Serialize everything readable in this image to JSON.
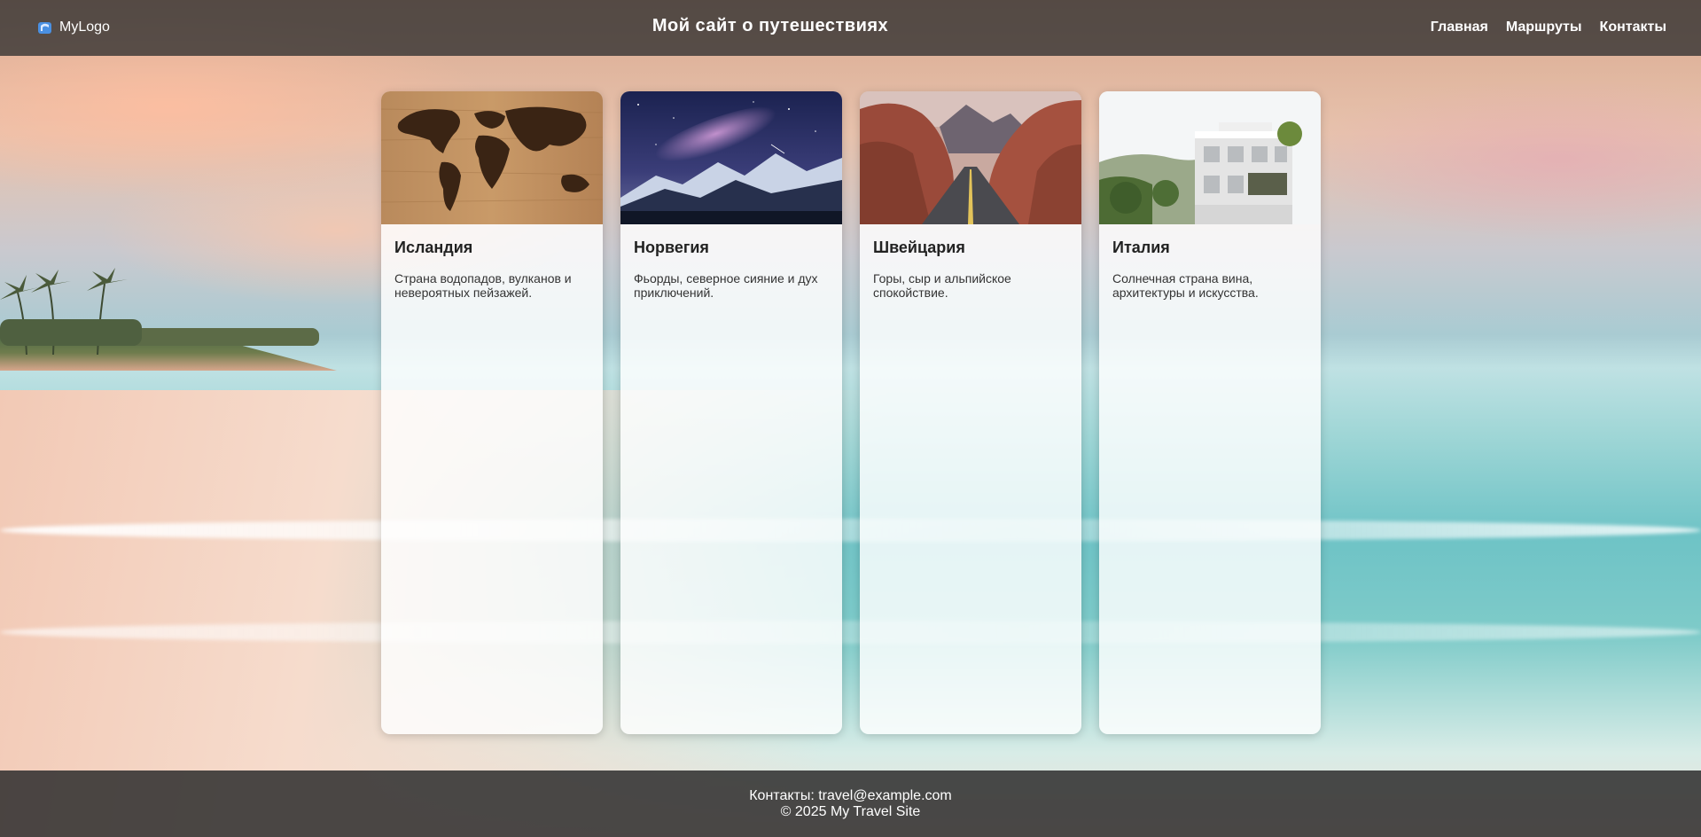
{
  "header": {
    "logo_text": "MyLogo",
    "site_title": "Мой сайт о путешествиях",
    "nav": [
      {
        "label": "Главная"
      },
      {
        "label": "Маршруты"
      },
      {
        "label": "Контакты"
      }
    ]
  },
  "cards": [
    {
      "title": "Исландия",
      "text": "Страна водопадов, вулканов и невероятных пейзажей.",
      "image": "world-map-on-wood"
    },
    {
      "title": "Норвегия",
      "text": "Фьорды, северное сияние и дух приключений.",
      "image": "night-mountains-milky-way"
    },
    {
      "title": "Швейцария",
      "text": "Горы, сыр и альпийское спокойствие.",
      "image": "desert-road-red-rocks"
    },
    {
      "title": "Италия",
      "text": "Солнечная страна вина, архитектуры и искусства.",
      "image": "modern-white-building"
    }
  ],
  "footer": {
    "contacts": "Контакты: travel@example.com",
    "copyright": "© 2025 My Travel Site"
  },
  "colors": {
    "header_bg": "#303030",
    "footer_bg": "#2d2d2d",
    "card_bg": "#ffffff",
    "logo_accent": "#4a90e2"
  }
}
